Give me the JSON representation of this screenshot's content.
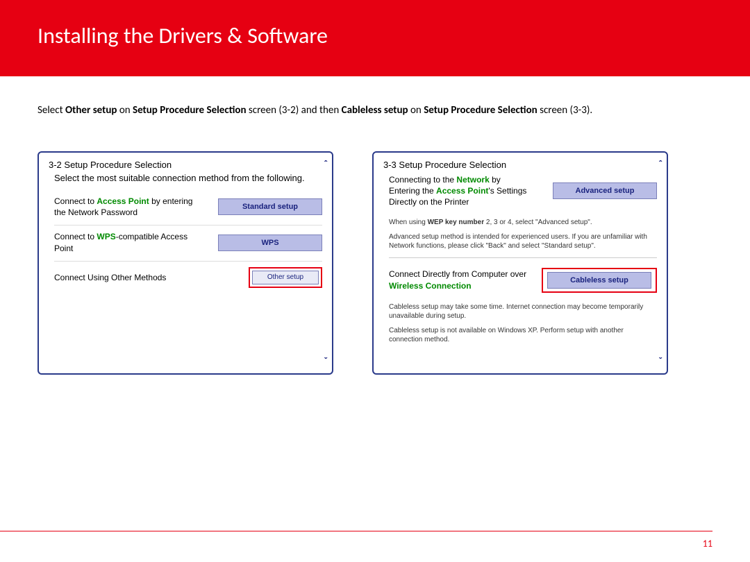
{
  "header": {
    "title": "Installing  the Drivers & Software"
  },
  "instruction": {
    "t1": "Select  ",
    "b1": "Other setup ",
    "t2": "on ",
    "b2": "Setup Procedure Selection ",
    "t3": "screen (3-2) and then  ",
    "b3": "Cableless setup ",
    "t4": "on ",
    "b4": "Setup Procedure Selection ",
    "t5": "screen (3-3)."
  },
  "panel_left": {
    "title": "3-2 Setup Procedure Selection",
    "subtitle": "Select the most suitable connection method from the following.",
    "opt1_pre": "Connect to ",
    "opt1_green": "Access Point",
    "opt1_post": " by entering the Network Password",
    "btn1": "Standard setup",
    "opt2_pre": "Connect to ",
    "opt2_green": "WPS",
    "opt2_post": "-compatible Access Point",
    "btn2": "WPS",
    "opt3": "Connect Using Other Methods",
    "btn3": "Other setup"
  },
  "panel_right": {
    "title": "3-3 Setup Procedure Selection",
    "opt1_l1a": "Connecting to the ",
    "opt1_l1g": "Network",
    "opt1_l1b": " by",
    "opt1_l2a": "Entering the ",
    "opt1_l2g": "Access Point",
    "opt1_l2b": "'s Settings",
    "opt1_l3": "Directly on the Printer",
    "btn1": "Advanced setup",
    "note1a": "When using ",
    "note1b": "WEP key number",
    "note1c": " 2, 3 or 4, select \"Advanced setup\".",
    "note2": "Advanced setup method is intended for experienced users. If you are unfamiliar with Network functions, please click \"Back\" and select \"Standard setup\".",
    "opt2_l1": "Connect Directly from Computer over",
    "opt2_l2": "Wireless Connection",
    "btn2": "Cableless setup",
    "note3": "Cableless setup may take some time. Internet connection may become temporarily unavailable during setup.",
    "note4": "Cableless setup is not available on Windows XP. Perform setup with another connection method."
  },
  "page_number": "11",
  "arrows": {
    "up": "ˆ",
    "down": "ˇ"
  }
}
